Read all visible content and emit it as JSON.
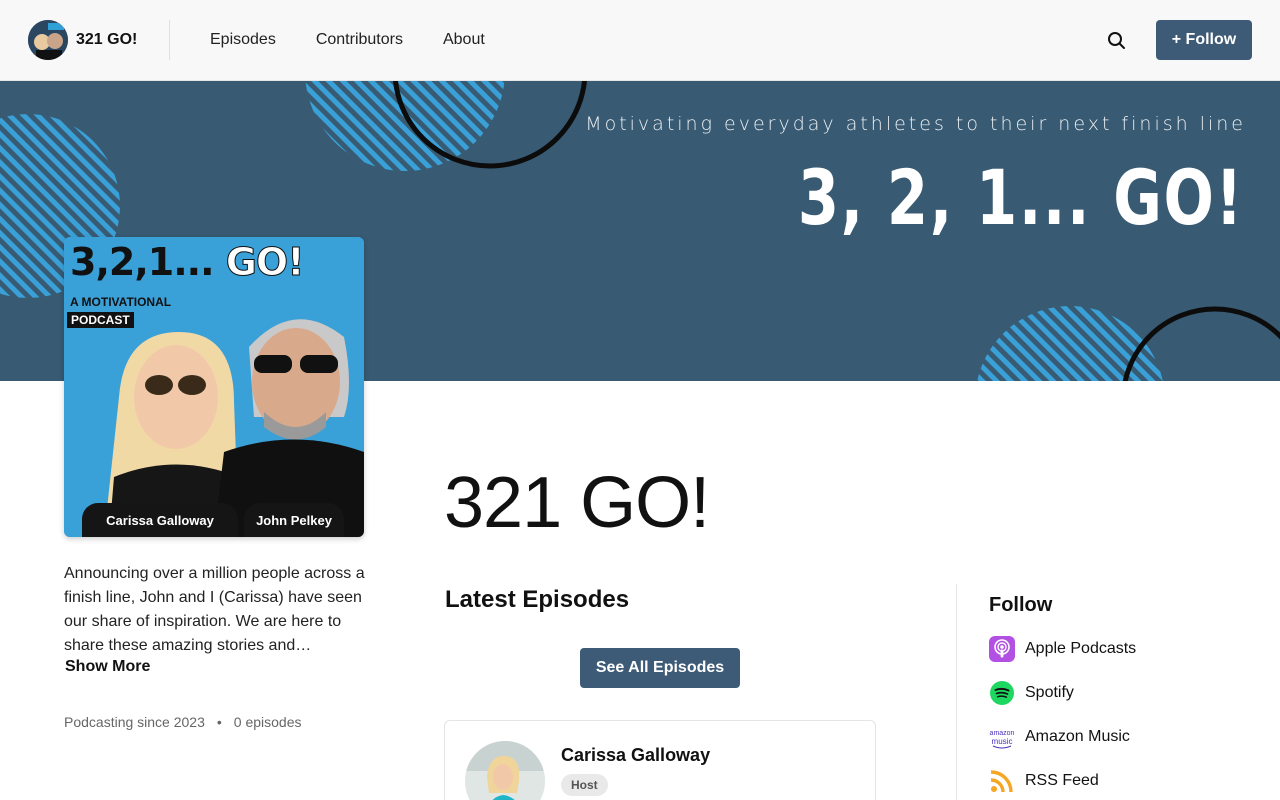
{
  "header": {
    "brand_title": "321 GO!",
    "nav": [
      "Episodes",
      "Contributors",
      "About"
    ],
    "follow_label": "+ Follow"
  },
  "banner": {
    "tagline": "Motivating everyday athletes to their next finish line",
    "headline": "3, 2, 1... GO!"
  },
  "cover": {
    "title_main": "3,2,1...",
    "title_go": "GO!",
    "subtitle": "A MOTIVATIONAL",
    "tag": "PODCAST",
    "name_left": "Carissa Galloway",
    "name_right": "John Pelkey"
  },
  "about": {
    "description": "Announcing over a million people across a finish line, John and I (Carissa) have seen our share of inspiration. We are here to share these amazing stories and…",
    "show_more": "Show More",
    "since": "Podcasting since 2023",
    "separator": "•",
    "episodes": "0 episodes"
  },
  "main": {
    "title": "321 GO!",
    "latest_heading": "Latest Episodes",
    "see_all": "See All Episodes",
    "contributor": {
      "name": "Carissa Galloway",
      "role": "Host"
    }
  },
  "follow": {
    "heading": "Follow",
    "items": [
      {
        "label": "Apple Podcasts",
        "icon": "apple-podcasts-icon",
        "color": "#b150e2"
      },
      {
        "label": "Spotify",
        "icon": "spotify-icon",
        "color": "#1ed760"
      },
      {
        "label": "Amazon Music",
        "icon": "amazon-music-icon",
        "color": "#4a2fbd"
      },
      {
        "label": "RSS Feed",
        "icon": "rss-icon",
        "color": "#f5a623"
      }
    ]
  },
  "colors": {
    "accent": "#3d5a76",
    "banner": "#385a72"
  }
}
